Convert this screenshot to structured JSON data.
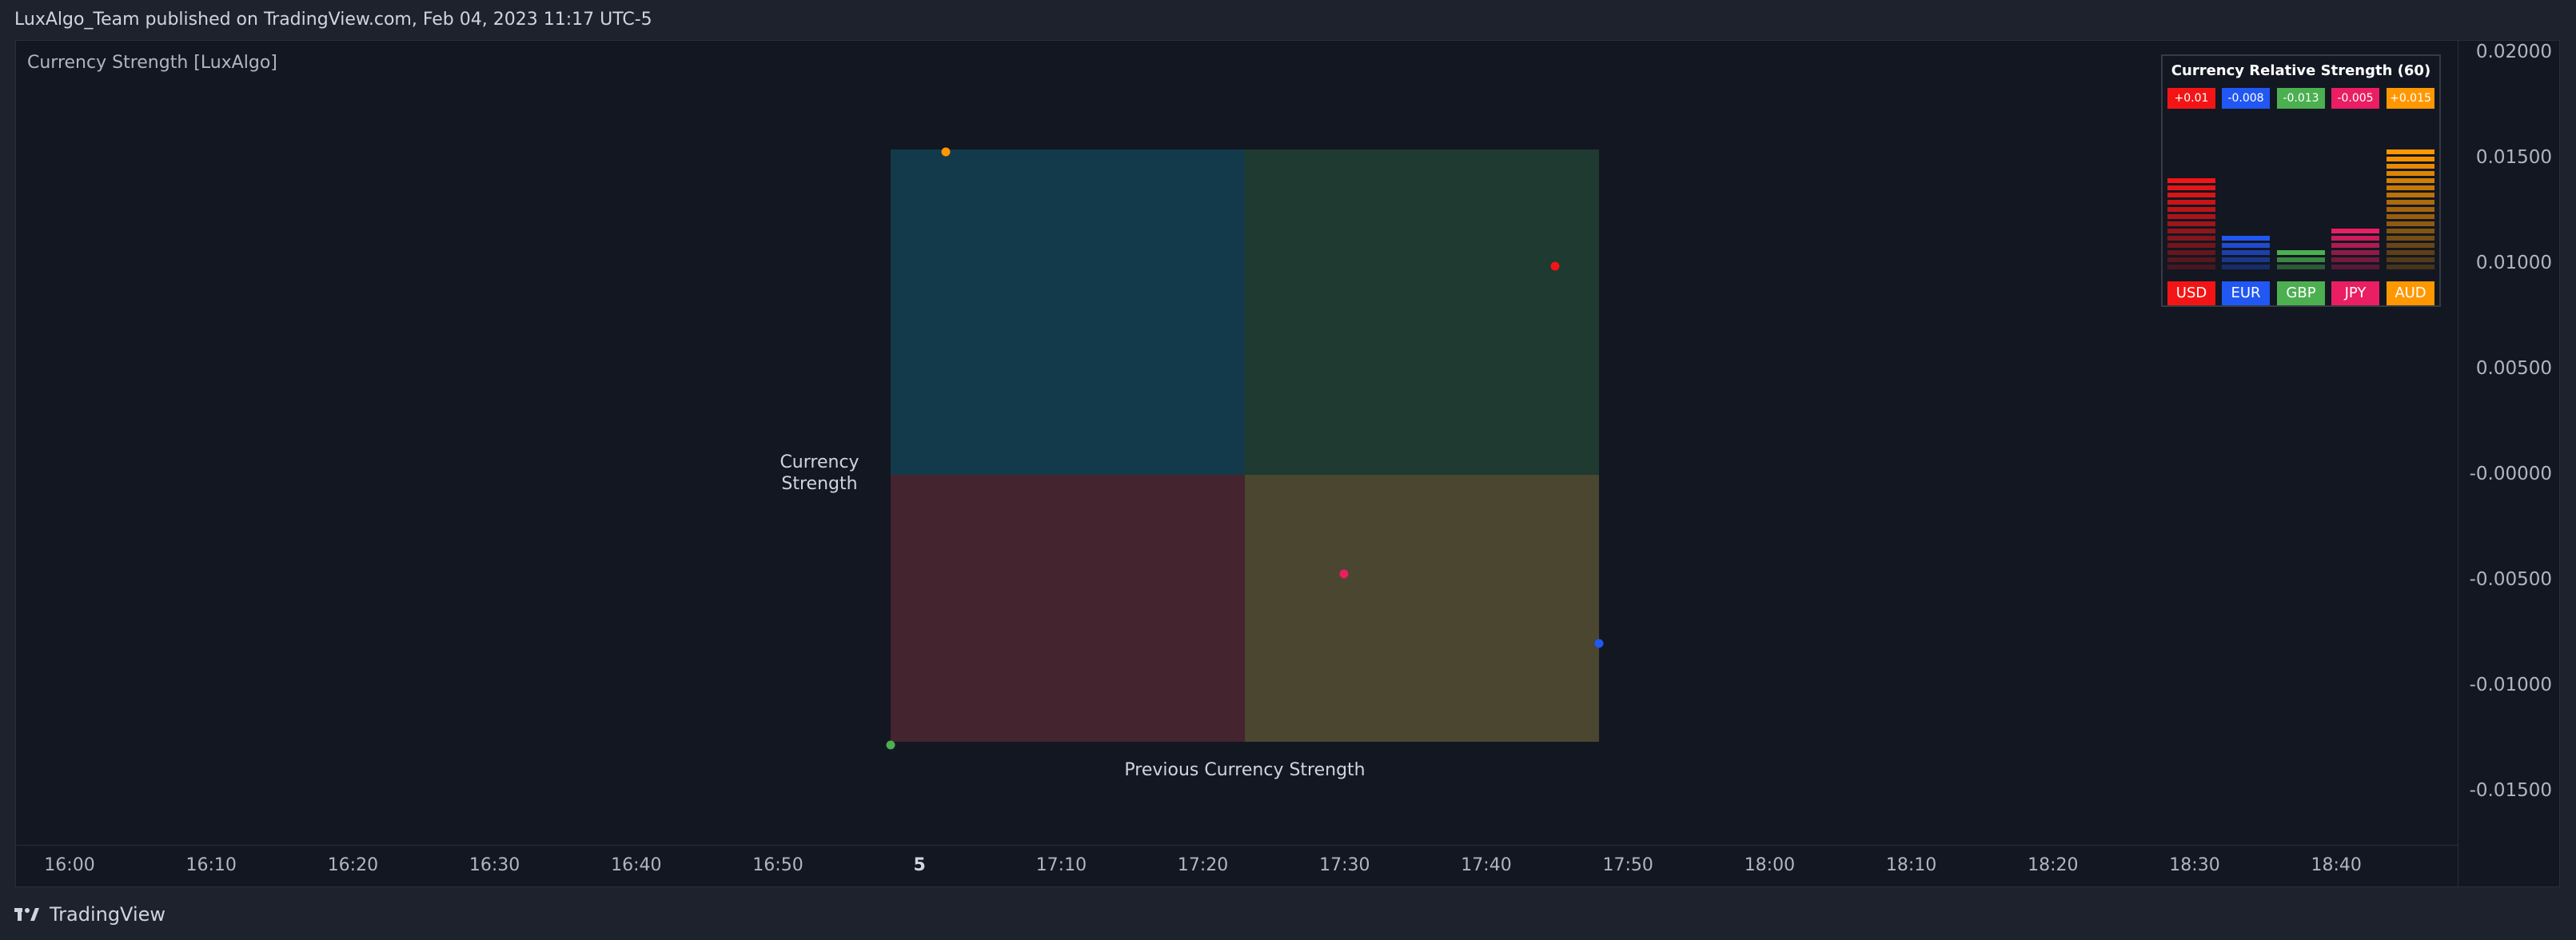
{
  "header": {
    "published_text": "LuxAlgo_Team published on TradingView.com, Feb 04, 2023 11:17 UTC-5"
  },
  "indicator": {
    "title": "Currency Strength [LuxAlgo]"
  },
  "footer": {
    "brand": "TradingView"
  },
  "chart_data": [
    {
      "type": "scatter",
      "title": "",
      "xlabel": "Previous Currency Strength",
      "ylabel": "Currency\nStrength",
      "ylim": [
        -0.0165,
        0.0205
      ],
      "grid": false,
      "quadrant_colors": {
        "top_left": "#133a4b",
        "top_right": "#1f3a30",
        "bottom_left": "#44242f",
        "bottom_right": "#4a4630"
      },
      "points": [
        {
          "name": "USD",
          "color": "#f31515",
          "y": 0.0099
        },
        {
          "name": "EUR",
          "color": "#2157f3",
          "y": -0.008
        },
        {
          "name": "GBP",
          "color": "#4caf50",
          "y": -0.0128
        },
        {
          "name": "JPY",
          "color": "#e91e63",
          "y": -0.0047
        },
        {
          "name": "AUD",
          "color": "#ff9800",
          "y": 0.0153
        }
      ],
      "y_ticks": [
        "0.02000",
        "0.01500",
        "0.01000",
        "0.00500",
        "-0.00000",
        "-0.00500",
        "-0.01000",
        "-0.01500"
      ],
      "x_ticks": [
        "16:00",
        "16:10",
        "16:20",
        "16:30",
        "16:40",
        "16:50",
        "5",
        "17:10",
        "17:20",
        "17:30",
        "17:40",
        "17:50",
        "18:00",
        "18:10",
        "18:20",
        "18:30",
        "18:40"
      ]
    },
    {
      "type": "bar",
      "title": "Currency Relative Strength (60)",
      "categories": [
        "USD",
        "EUR",
        "GBP",
        "JPY",
        "AUD"
      ],
      "value_labels": [
        "+0.01",
        "-0.008",
        "-0.013",
        "-0.005",
        "+0.015"
      ],
      "values": [
        0.01,
        -0.008,
        -0.013,
        -0.005,
        0.015
      ],
      "bar_levels": [
        0.56,
        0.12,
        0.0,
        0.19,
        0.8
      ],
      "colors": [
        "#f31515",
        "#2157f3",
        "#4caf50",
        "#e91e63",
        "#ff9800"
      ]
    }
  ]
}
